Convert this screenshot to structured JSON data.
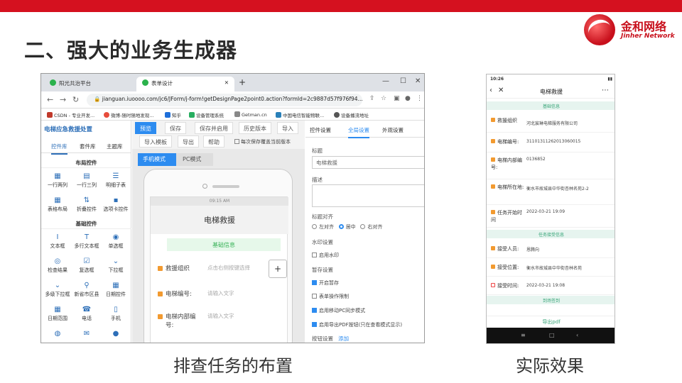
{
  "slide": {
    "title": "二、强大的业务生成器",
    "caption_left": "排查任务的布置",
    "caption_right": "实际效果",
    "accent_color": "#d5111f"
  },
  "logo": {
    "cn": "金和网络",
    "en": "Jinher Network"
  },
  "browser": {
    "tabs": [
      {
        "label": "阳光共治平台",
        "active": false
      },
      {
        "label": "表单设计",
        "active": true
      }
    ],
    "new_tab": "+",
    "url": "jianguan.iuoooo.com/jc6/JForm/j-form!getDesignPage2point0.action?formId=2c9887d57f976f94...",
    "bookmarks": [
      "CSDN - 专业开发...",
      "微博-随时随地发现...",
      "知乎",
      "设备管理系统",
      "Getman.cn",
      "中国电信智能物联...",
      "设备播流地址"
    ]
  },
  "designer": {
    "project_title": "电梯应急救援处置",
    "lib_tabs": [
      "控件库",
      "套件库",
      "主题库"
    ],
    "sections": [
      "布局控件",
      "基础控件"
    ],
    "layout_controls": [
      "一行两列",
      "一行三列",
      "明细子表",
      "表格布局",
      "折叠控件",
      "选项卡控件"
    ],
    "basic_controls": [
      "文本框",
      "多行文本框",
      "单选框",
      "检查结果",
      "复选框",
      "下拉框",
      "多级下拉框",
      "新省市区县",
      "日期控件",
      "日期范围",
      "电话",
      "手机"
    ],
    "toolbar": [
      "预览",
      "保存",
      "保存并启用",
      "历史版本",
      "导入",
      "导入模板",
      "导出",
      "帮助"
    ],
    "overwrite_label": "每次保存覆盖当前版本",
    "mode_tabs": [
      "手机模式",
      "PC模式"
    ],
    "phone": {
      "time": "09:15 AM",
      "title": "电梯救援",
      "section": "基础信息",
      "rows": [
        {
          "label": "救援组织",
          "placeholder": "点击右侧按键选择"
        },
        {
          "label": "电梯编号:",
          "placeholder": "请输入文字"
        },
        {
          "label": "电梯内部编",
          "label2": "号:",
          "placeholder": "请输入文字"
        }
      ],
      "plus": "+"
    }
  },
  "props": {
    "tabs": [
      "控件设置",
      "全局设置",
      "外观设置"
    ],
    "title_label": "标题",
    "title_value": "电梯救援",
    "desc_label": "描述",
    "align_label": "标题对齐",
    "align_options": [
      {
        "label": "左对齐",
        "checked": false
      },
      {
        "label": "居中",
        "checked": true
      },
      {
        "label": "右对齐",
        "checked": false
      }
    ],
    "watermark_label": "水印设置",
    "watermark_option": "启用水印",
    "draft_label": "暂存设置",
    "options": [
      {
        "label": "开启暂存",
        "checked": true
      },
      {
        "label": "表单操作限制",
        "checked": false
      },
      {
        "label": "启用移动PC同步模式",
        "checked": true
      },
      {
        "label": "启用导出PDF按钮(只在查看模式显示)",
        "checked": true
      }
    ],
    "button_label": "按钮设置",
    "add_link": "添加"
  },
  "mobile": {
    "status_time": "10:26",
    "title": "电梯救援",
    "sections": [
      "基础信息",
      "任务接受信息",
      "到场签到"
    ],
    "rows_basic": [
      {
        "label": "救援组织",
        "value": "河北宸琳电梯服务有限公司"
      },
      {
        "label": "电梯编号:",
        "value": "31101311262013060015"
      },
      {
        "label": "电梯内部编号:",
        "value": "0136852"
      },
      {
        "label": "电梯所在地:",
        "value": "衡水市故城县中华街杏林名苑2-2"
      },
      {
        "label": "任务开始时间",
        "value": "2022-03-21 19:09"
      }
    ],
    "rows_accept": [
      {
        "label": "接受人员:",
        "value": "恩腾向"
      },
      {
        "label": "接受位置:",
        "value": "衡水市故城县中华街杏林名苑"
      },
      {
        "label": "接受时间:",
        "value": "2022-03-21 19:08"
      }
    ],
    "export": "导出pdf"
  }
}
